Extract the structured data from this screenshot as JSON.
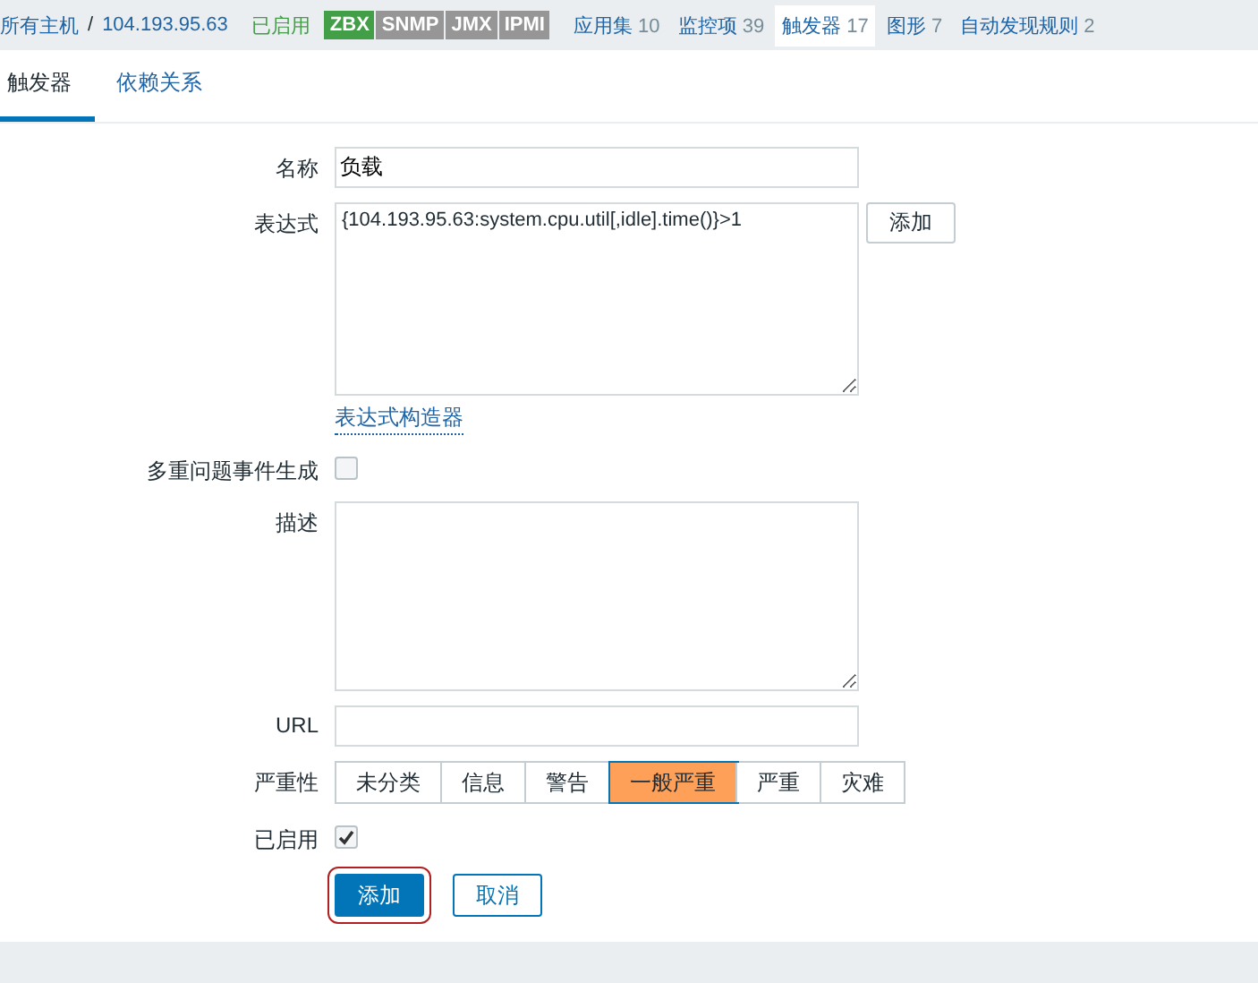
{
  "header": {
    "breadcrumbs": [
      "所有主机",
      "104.193.95.63"
    ],
    "separator": "/",
    "status": "已启用",
    "badges": [
      {
        "label": "ZBX",
        "on": true
      },
      {
        "label": "SNMP",
        "on": false
      },
      {
        "label": "JMX",
        "on": false
      },
      {
        "label": "IPMI",
        "on": false
      }
    ],
    "nav": [
      {
        "label": "应用集",
        "count": "10",
        "selected": false
      },
      {
        "label": "监控项",
        "count": "39",
        "selected": false
      },
      {
        "label": "触发器",
        "count": "17",
        "selected": true
      },
      {
        "label": "图形",
        "count": "7",
        "selected": false
      },
      {
        "label": "自动发现规则",
        "count": "2",
        "selected": false
      }
    ]
  },
  "tabs": [
    {
      "label": "触发器",
      "selected": true
    },
    {
      "label": "依赖关系",
      "selected": false
    }
  ],
  "form": {
    "rows": [
      {
        "kind": "text",
        "label": "名称",
        "value": "负载"
      },
      {
        "kind": "textarea",
        "label": "表达式",
        "value": "{104.193.95.63:system.cpu.util[,idle].time()}>1",
        "button": "添加",
        "link": "表达式构造器"
      },
      {
        "kind": "checkbox",
        "label": "多重问题事件生成",
        "checked": false
      },
      {
        "kind": "textarea",
        "label": "描述"
      },
      {
        "kind": "text",
        "label": "URL"
      },
      {
        "kind": "severity",
        "label": "严重性",
        "options": [
          {
            "label": "未分类",
            "selected": false
          },
          {
            "label": "信息",
            "selected": false
          },
          {
            "label": "警告",
            "selected": false
          },
          {
            "label": "一般严重",
            "selected": true
          },
          {
            "label": "严重",
            "selected": false
          },
          {
            "label": "灾难",
            "selected": false
          }
        ]
      },
      {
        "kind": "checkbox",
        "label": "已启用",
        "checked": true
      }
    ]
  },
  "buttons": [
    {
      "label": "添加",
      "kind": "primary"
    },
    {
      "label": "取消",
      "kind": "secondary"
    }
  ]
}
